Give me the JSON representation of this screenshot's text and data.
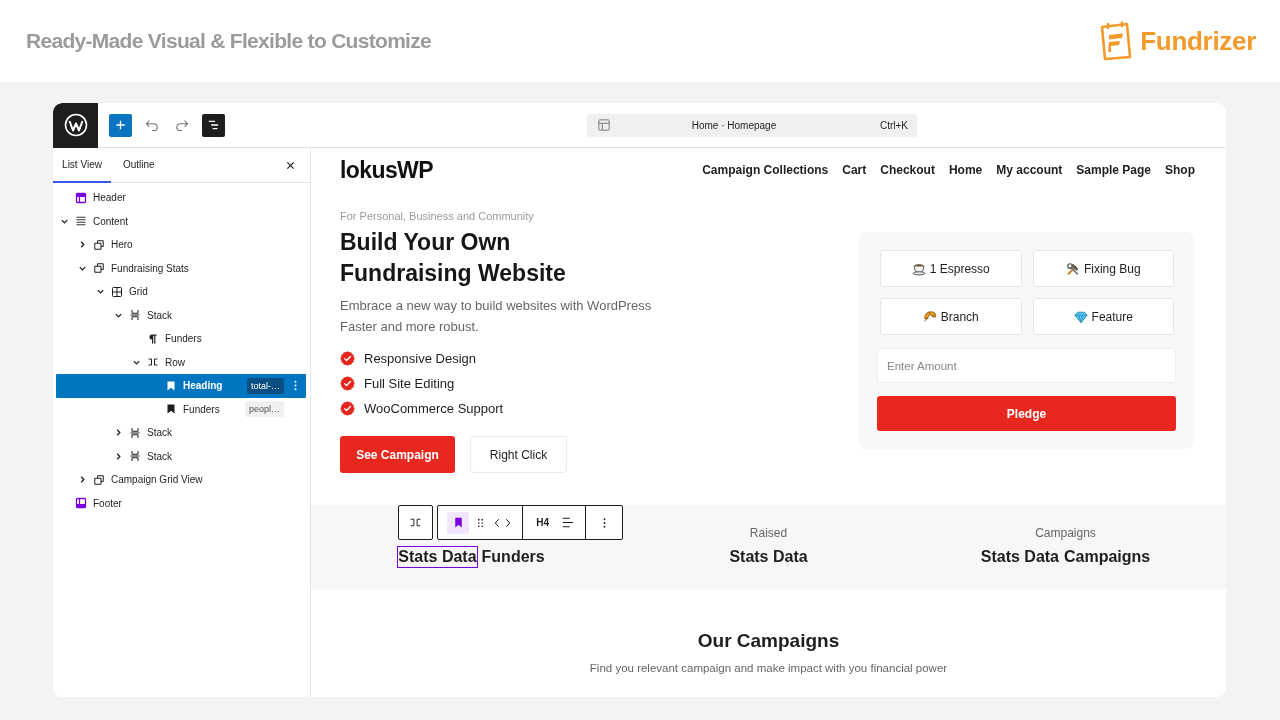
{
  "banner": {
    "title": "Ready-Made Visual & Flexible to Customize",
    "brand": "Fundrizer"
  },
  "editor": {
    "toolbar": {
      "command_bar": {
        "label": "Home · Homepage",
        "shortcut": "Ctrl+K"
      }
    },
    "sidebar": {
      "tabs": [
        {
          "label": "List View",
          "selected": true
        },
        {
          "label": "Outline",
          "selected": false
        }
      ],
      "tree": [
        {
          "label": "Header",
          "kind": "header",
          "selected": false
        },
        {
          "label": "Content",
          "kind": "content",
          "selected": false,
          "expanded": true,
          "children": [
            {
              "label": "Hero",
              "kind": "group",
              "selected": false,
              "expanded": false
            },
            {
              "label": "Fundraising Stats",
              "kind": "group",
              "selected": false,
              "expanded": true,
              "children": [
                {
                  "label": "Grid",
                  "kind": "grid",
                  "selected": false,
                  "expanded": true,
                  "children": [
                    {
                      "label": "Stack",
                      "kind": "stack",
                      "selected": false,
                      "expanded": true,
                      "children": [
                        {
                          "label": "Funders",
                          "kind": "paragraph",
                          "selected": false
                        },
                        {
                          "label": "Row",
                          "kind": "row",
                          "selected": false,
                          "expanded": true,
                          "children": [
                            {
                              "label": "Heading",
                              "kind": "heading",
                              "selected": true,
                              "badge": "total-…"
                            },
                            {
                              "label": "Funders",
                              "kind": "heading",
                              "selected": false,
                              "badge": "peopl…"
                            }
                          ]
                        }
                      ]
                    },
                    {
                      "label": "Stack",
                      "kind": "stack",
                      "selected": false,
                      "expanded": false
                    },
                    {
                      "label": "Stack",
                      "kind": "stack",
                      "selected": false,
                      "expanded": false
                    }
                  ]
                }
              ]
            },
            {
              "label": "Campaign Grid View",
              "kind": "group",
              "selected": false,
              "expanded": false
            }
          ]
        },
        {
          "label": "Footer",
          "kind": "footer",
          "selected": false
        }
      ]
    },
    "canvas": {
      "site_header": {
        "logo": "lokusWP",
        "nav": [
          "Campaign Collections",
          "Cart",
          "Checkout",
          "Home",
          "My account",
          "Sample Page",
          "Shop"
        ]
      },
      "hero": {
        "eyebrow": "For Personal, Business and Community",
        "title_lines": [
          "Build Your Own",
          "Fundraising Website"
        ],
        "description_lines": [
          "Embrace a new way to build websites with WordPress",
          "Faster and more robust."
        ],
        "features": [
          "Responsive Design",
          "Full Site Editing",
          "WooCommerce Support"
        ],
        "buttons": [
          {
            "label": "See Campaign",
            "kind": "primary"
          },
          {
            "label": "Right Click",
            "kind": "secondary"
          }
        ]
      },
      "donation_card": {
        "options": [
          "1 Espresso",
          "Fixing Bug",
          "Branch",
          "Feature"
        ],
        "amount": {
          "placeholder": "Enter Amount"
        },
        "submit": "Pledge"
      },
      "stats": [
        {
          "value": "Stats Data",
          "unit": "Funders",
          "selected": true
        },
        {
          "label": "Raised",
          "value": "Stats Data",
          "selected": false
        },
        {
          "label": "Campaigns",
          "value": "Stats Data",
          "unit": "Campaigns",
          "selected": false
        }
      ],
      "block_toolbar": {
        "heading_level": "H4"
      },
      "campaigns": {
        "title": "Our Campaigns",
        "subtitle": "Find you relevant campaign and make impact with you financial power"
      }
    }
  }
}
